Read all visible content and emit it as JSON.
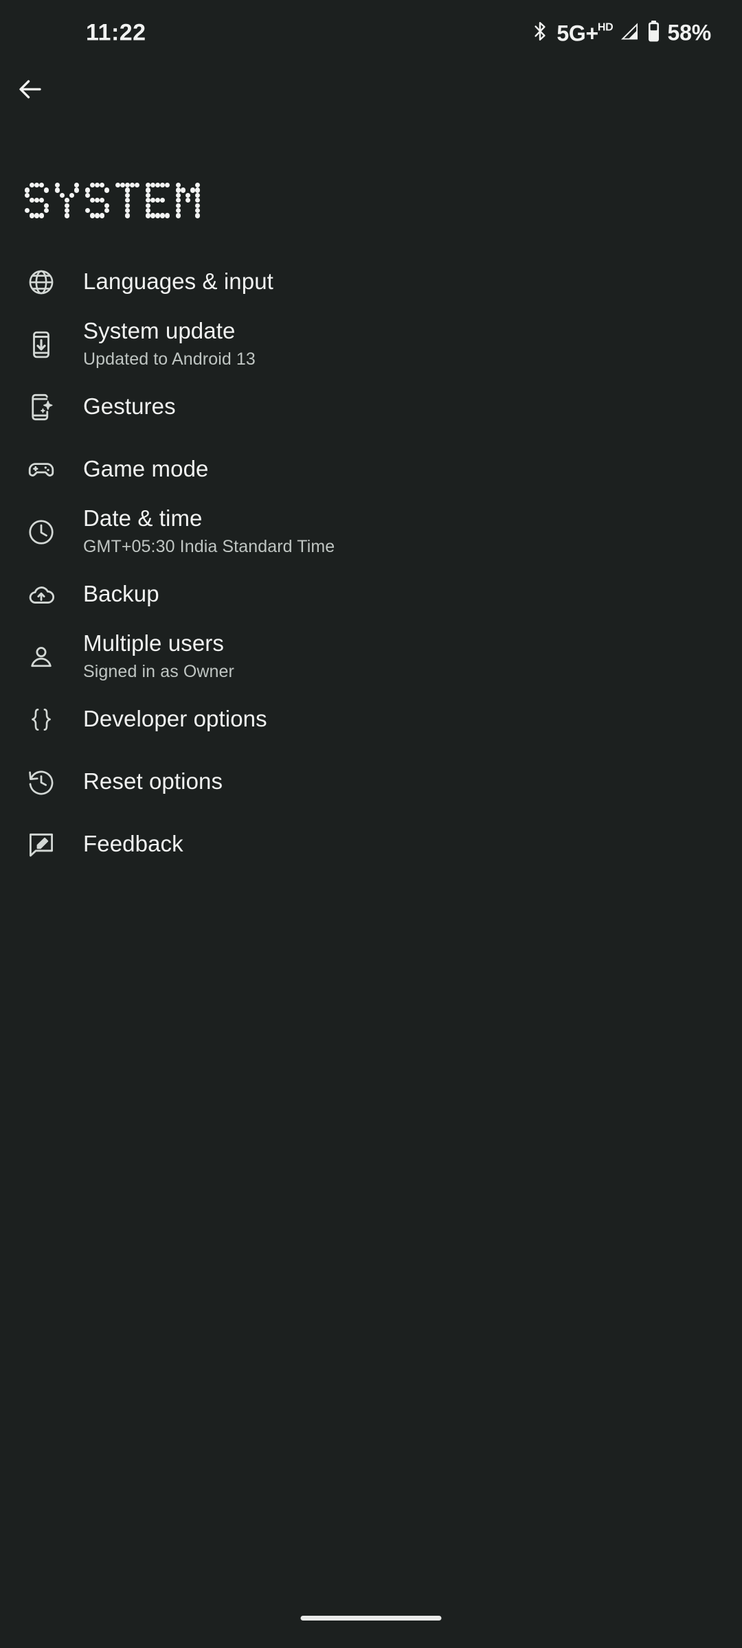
{
  "status_bar": {
    "time": "11:22",
    "bluetooth_icon": "bluetooth-icon",
    "network_label": "5G",
    "network_plus": "+",
    "network_hd": "HD",
    "signal_icon": "signal-bars-icon",
    "battery_icon": "battery-icon",
    "battery_percent": "58%"
  },
  "navigation": {
    "back_icon": "arrow-back-icon"
  },
  "header": {
    "title": "SYSTEM"
  },
  "colors": {
    "background": "#1c201f",
    "primary_text": "#f1f2f1",
    "secondary_text": "#bfc5c2",
    "icon": "#d3d8d5"
  },
  "list": {
    "items": [
      {
        "id": "languages-and-input",
        "icon": "globe-icon",
        "label": "Languages & input",
        "sublabel": ""
      },
      {
        "id": "system-update",
        "icon": "phone-download-icon",
        "label": "System update",
        "sublabel": "Updated to Android 13"
      },
      {
        "id": "gestures",
        "icon": "phone-sparkle-icon",
        "label": "Gestures",
        "sublabel": ""
      },
      {
        "id": "game-mode",
        "icon": "gamepad-icon",
        "label": "Game mode",
        "sublabel": ""
      },
      {
        "id": "date-and-time",
        "icon": "clock-icon",
        "label": "Date & time",
        "sublabel": "GMT+05:30 India Standard Time"
      },
      {
        "id": "backup",
        "icon": "cloud-upload-icon",
        "label": "Backup",
        "sublabel": ""
      },
      {
        "id": "multiple-users",
        "icon": "person-icon",
        "label": "Multiple users",
        "sublabel": "Signed in as Owner"
      },
      {
        "id": "developer-options",
        "icon": "curly-braces-icon",
        "label": "Developer options",
        "sublabel": ""
      },
      {
        "id": "reset-options",
        "icon": "history-restore-icon",
        "label": "Reset options",
        "sublabel": ""
      },
      {
        "id": "feedback",
        "icon": "feedback-icon",
        "label": "Feedback",
        "sublabel": ""
      }
    ]
  },
  "system_nav": {
    "home_indicator": "home-indicator"
  }
}
